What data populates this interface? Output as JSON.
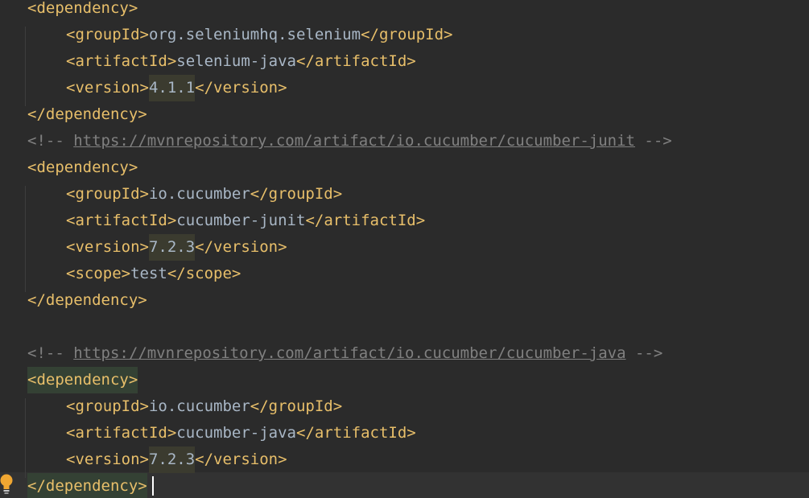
{
  "editor": {
    "lines": [
      {
        "kind": "tag",
        "text": "<dependency>"
      },
      {
        "kind": "elem",
        "open": "<groupId>",
        "value": "org.seleniumhq.selenium",
        "close": "</groupId>"
      },
      {
        "kind": "elem",
        "open": "<artifactId>",
        "value": "selenium-java",
        "close": "</artifactId>"
      },
      {
        "kind": "version",
        "open": "<version>",
        "value": "4.1.1",
        "close": "</version>"
      },
      {
        "kind": "tag",
        "text": "</dependency>"
      },
      {
        "kind": "comment",
        "open": "<!-- ",
        "url": "https://mvnrepository.com/artifact/io.cucumber/cucumber-junit",
        "close": " -->"
      },
      {
        "kind": "tag",
        "text": "<dependency>"
      },
      {
        "kind": "elem",
        "open": "<groupId>",
        "value": "io.cucumber",
        "close": "</groupId>"
      },
      {
        "kind": "elem",
        "open": "<artifactId>",
        "value": "cucumber-junit",
        "close": "</artifactId>"
      },
      {
        "kind": "version",
        "open": "<version>",
        "value": "7.2.3",
        "close": "</version>"
      },
      {
        "kind": "elem",
        "open": "<scope>",
        "value": "test",
        "close": "</scope>"
      },
      {
        "kind": "tag",
        "text": "</dependency>"
      },
      {
        "kind": "blank",
        "text": ""
      },
      {
        "kind": "comment",
        "open": "<!-- ",
        "url": "https://mvnrepository.com/artifact/io.cucumber/cucumber-java",
        "close": " -->"
      },
      {
        "kind": "tag",
        "text": "<dependency>"
      },
      {
        "kind": "elem",
        "open": "<groupId>",
        "value": "io.cucumber",
        "close": "</groupId>"
      },
      {
        "kind": "elem",
        "open": "<artifactId>",
        "value": "cucumber-java",
        "close": "</artifactId>"
      },
      {
        "kind": "version",
        "open": "<version>",
        "value": "7.2.3",
        "close": "</version>"
      },
      {
        "kind": "tag",
        "text": "</dependency>"
      }
    ]
  },
  "icons": {
    "intention": "lightbulb-icon"
  },
  "colors": {
    "background": "#2b2b2b",
    "tag": "#e8bf6a",
    "text": "#a9b7c6",
    "comment": "#808080",
    "matched_tag_background": "#344134",
    "version_highlight": "#3b3b2f",
    "bulb": "#f0a732"
  }
}
